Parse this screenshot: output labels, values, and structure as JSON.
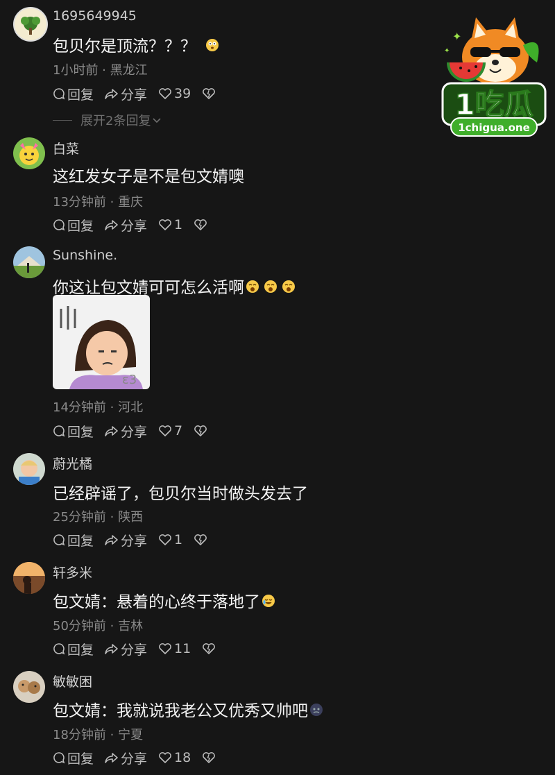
{
  "comments": [
    {
      "user": "1695649945",
      "text": "包贝尔是顶流？？？",
      "meta": "1小时前 · 黑龙江",
      "reply": "回复",
      "share": "分享",
      "likes": "39",
      "expand": "展开2条回复"
    },
    {
      "user": "白菜",
      "text": "这红发女子是不是包文婧噢",
      "meta": "13分钟前 · 重庆",
      "reply": "回复",
      "share": "分享",
      "likes": "1"
    },
    {
      "user": "Sunshine.",
      "text": "你这让包文婧可可怎么活啊",
      "meta": "14分钟前 · 河北",
      "reply": "回复",
      "share": "分享",
      "likes": "7"
    },
    {
      "user": "蔚光橘",
      "text": "已经辟谣了，包贝尔当时做头发去了",
      "meta": "25分钟前 · 陕西",
      "reply": "回复",
      "share": "分享",
      "likes": "1"
    },
    {
      "user": "轩多米",
      "text": "包文婧：悬着的心终于落地了",
      "meta": "50分钟前 · 吉林",
      "reply": "回复",
      "share": "分享",
      "likes": "11"
    },
    {
      "user": "敏敏困",
      "text": "包文婧：我就说我老公又优秀又帅吧",
      "meta": "18分钟前 · 宁夏",
      "reply": "回复",
      "share": "分享",
      "likes": "18"
    }
  ],
  "logo": {
    "brand": "1吃瓜",
    "url": "1chigua.one"
  },
  "colors": {
    "background": "#161616",
    "logo_green": "#3fae2a",
    "logo_orange": "#f08a24"
  }
}
